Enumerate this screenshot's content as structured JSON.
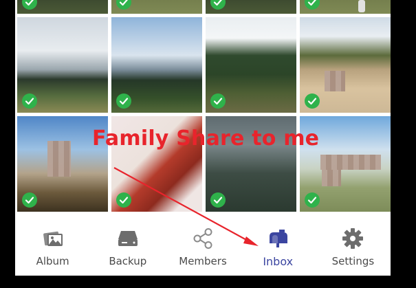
{
  "overlay": {
    "annotation": "Family Share to me"
  },
  "colors": {
    "accent": "#3b45a0",
    "check": "#2fb24b",
    "annotation": "#e8242c"
  },
  "photos": [
    {
      "scene": "dark-top",
      "selected": true
    },
    {
      "scene": "olive-top",
      "selected": true
    },
    {
      "scene": "dark-top",
      "selected": true
    },
    {
      "scene": "olive-top",
      "selected": true
    },
    {
      "scene": "sky-cloud",
      "selected": true
    },
    {
      "scene": "sky-blue",
      "selected": true
    },
    {
      "scene": "forest",
      "selected": true
    },
    {
      "scene": "beach",
      "selected": true
    },
    {
      "scene": "tower",
      "selected": true
    },
    {
      "scene": "drawing",
      "selected": true
    },
    {
      "scene": "mist",
      "selected": true
    },
    {
      "scene": "park",
      "selected": true
    }
  ],
  "tabs": [
    {
      "label": "Album",
      "icon": "album-icon",
      "active": false
    },
    {
      "label": "Backup",
      "icon": "backup-drive-icon",
      "active": false
    },
    {
      "label": "Members",
      "icon": "share-icon",
      "active": false
    },
    {
      "label": "Inbox",
      "icon": "inbox-mailbox-icon",
      "active": true
    },
    {
      "label": "Settings",
      "icon": "gear-icon",
      "active": false
    }
  ]
}
